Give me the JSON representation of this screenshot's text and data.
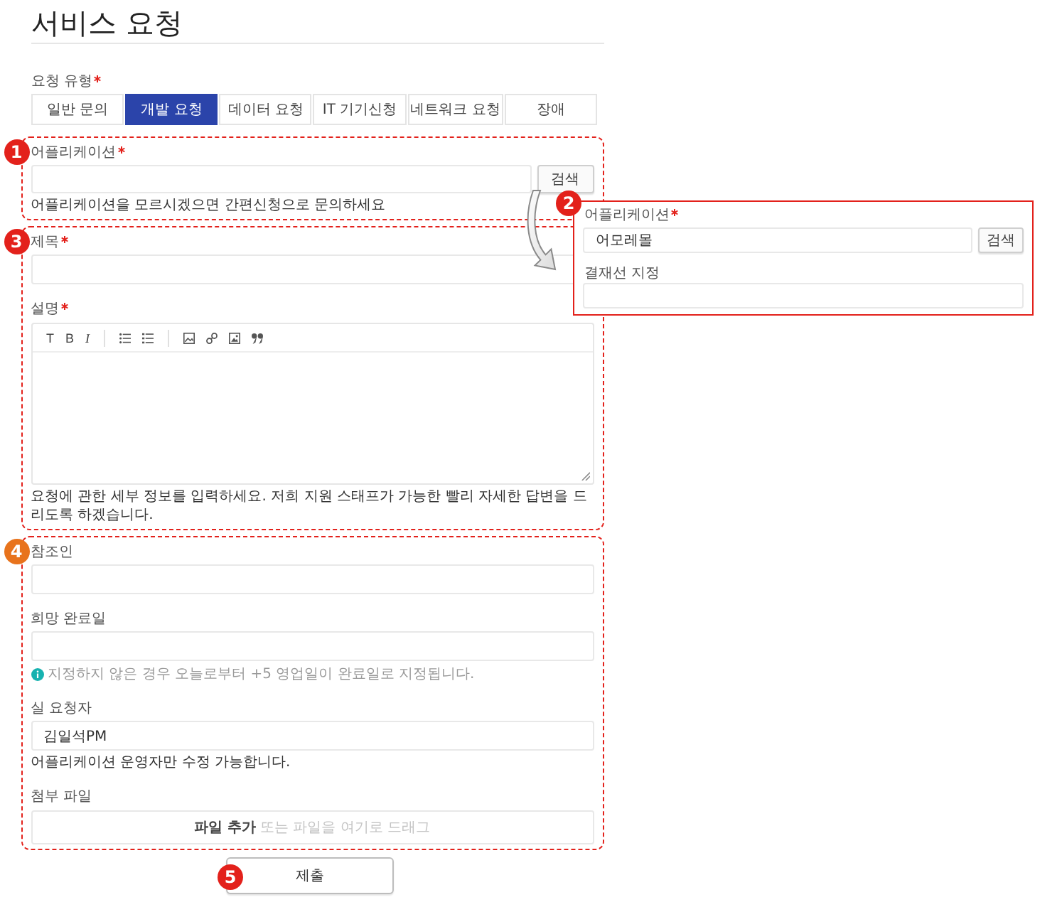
{
  "page": {
    "title": "서비스 요청"
  },
  "request_type": {
    "label": "요청 유형",
    "required": true,
    "tabs": [
      {
        "label": "일반 문의",
        "selected": false
      },
      {
        "label": "개발 요청",
        "selected": true
      },
      {
        "label": "데이터 요청",
        "selected": false
      },
      {
        "label": "IT 기기신청",
        "selected": false
      },
      {
        "label": "네트워크 요청",
        "selected": false
      },
      {
        "label": "장애",
        "selected": false
      }
    ]
  },
  "sections": [
    {
      "marker": {
        "number": "1",
        "color": "#e3211b"
      },
      "fields": [
        {
          "kind": "search",
          "label": "어플리케이션",
          "required": true,
          "button": "검색",
          "help": "어플리케이션을 모르시겠으면 간편신청으로 문의하세요"
        }
      ]
    },
    {
      "marker": {
        "number": "3",
        "color": "#e3211b"
      },
      "fields": [
        {
          "kind": "text",
          "label": "제목",
          "required": true
        },
        {
          "kind": "editor",
          "label": "설명",
          "required": true,
          "toolbar": [
            [
              {
                "kind": "heading",
                "label": "T"
              },
              {
                "kind": "bold",
                "label": "B"
              },
              {
                "kind": "italic",
                "label": "I"
              }
            ],
            [
              {
                "kind": "bullet_list"
              },
              {
                "kind": "numbered_list"
              }
            ],
            [
              {
                "kind": "image"
              },
              {
                "kind": "link"
              },
              {
                "kind": "embed"
              },
              {
                "kind": "quote"
              }
            ]
          ],
          "help": "요청에 관한 세부 정보를 입력하세요. 저희 지원 스태프가 가능한 빨리 자세한 답변을 드리도록 하겠습니다."
        }
      ]
    },
    {
      "marker": {
        "number": "4",
        "color": "#e8731c"
      },
      "fields": [
        {
          "kind": "text",
          "label": "참조인",
          "required": false
        },
        {
          "kind": "text",
          "label": "희망 완료일",
          "required": false,
          "info": "지정하지 않은 경우 오늘로부터 +5 영업일이 완료일로 지정됩니다."
        },
        {
          "kind": "text",
          "label": "실 요청자",
          "required": false,
          "value": "김일석PM",
          "help": "어플리케이션 운영자만 수정 가능합니다."
        },
        {
          "kind": "dropzone",
          "label": "첨부 파일",
          "required": false,
          "action": "파일 추가",
          "hint": "또는 파일을 여기로 드래그"
        }
      ]
    }
  ],
  "callout": {
    "marker": {
      "number": "2",
      "color": "#e3211b"
    },
    "fields": [
      {
        "kind": "search",
        "label": "어플리케이션",
        "required": true,
        "value": "어모레몰",
        "button": "검색"
      },
      {
        "kind": "text",
        "label": "결재선 지정",
        "required": false
      }
    ]
  },
  "submit": {
    "label": "제출",
    "marker": {
      "number": "5",
      "color": "#e3211b"
    }
  }
}
